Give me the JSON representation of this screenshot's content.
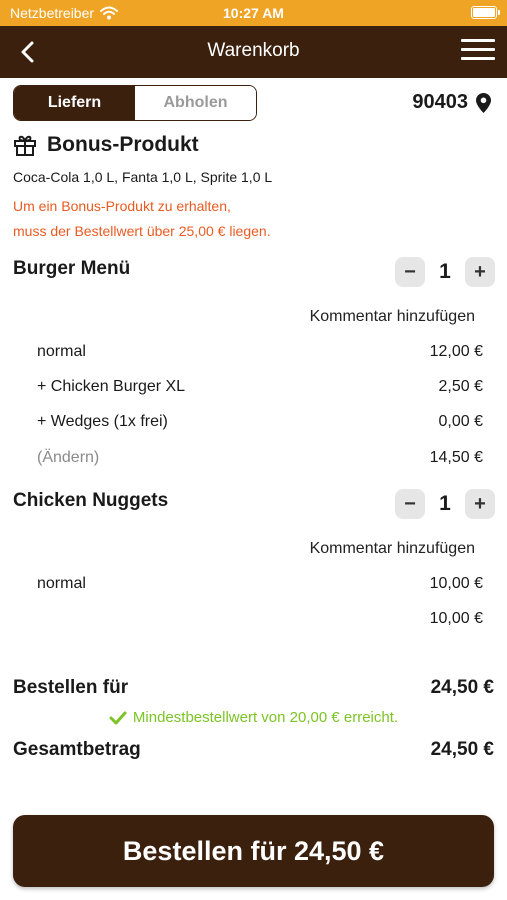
{
  "status_bar": {
    "carrier": "Netzbetreiber",
    "time": "10:27 AM"
  },
  "nav": {
    "title": "Warenkorb"
  },
  "delivery_toggle": {
    "options": [
      "Liefern",
      "Abholen"
    ],
    "selected": "Liefern"
  },
  "zip": "90403",
  "bonus": {
    "title": "Bonus-Produkt",
    "items": "Coca-Cola 1,0 L, Fanta 1,0 L, Sprite 1,0 L",
    "note_line1": "Um ein Bonus-Produkt zu erhalten,",
    "note_line2": "muss der Bestellwert über 25,00 € liegen."
  },
  "cart": [
    {
      "name": "Burger Menü",
      "qty": "1",
      "comment_label": "Kommentar hinzufügen",
      "lines": [
        {
          "label": "normal",
          "price": "12,00 €"
        },
        {
          "label": "+ Chicken Burger XL",
          "price": "2,50 €"
        },
        {
          "label": "+ Wedges (1x frei)",
          "price": "0,00 €"
        },
        {
          "label": "(Ändern)",
          "price": "14,50 €"
        }
      ]
    },
    {
      "name": "Chicken Nuggets",
      "qty": "1",
      "comment_label": "Kommentar hinzufügen",
      "lines": [
        {
          "label": "normal",
          "price": "10,00 €"
        },
        {
          "label": "",
          "price": "10,00 €"
        }
      ]
    }
  ],
  "summary": {
    "order_label": "Bestellen für",
    "order_value": "24,50 €",
    "min_order_msg": "Mindestbestellwert von 20,00 € erreicht.",
    "total_label": "Gesamtbetrag",
    "total_value": "24,50 €"
  },
  "order_button": "Bestellen für 24,50 €",
  "colors": {
    "status_bar": "#f0a426",
    "brand_brown": "#3b200d",
    "warning": "#ea5b22",
    "success": "#7cc425"
  }
}
